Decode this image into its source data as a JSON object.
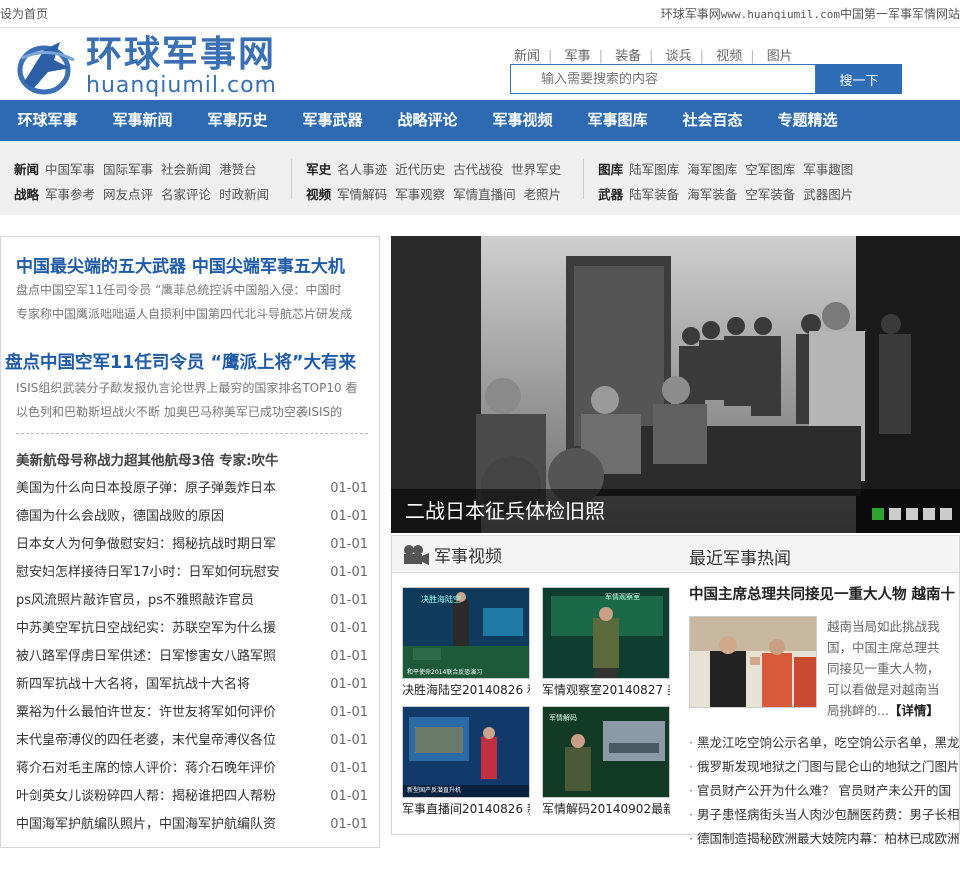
{
  "topbar": {
    "set_home": "设为首页",
    "site_pre": "环球军事网",
    "site_url": "www.huanqiumil.com",
    "site_post": "中国第一军事军情网站"
  },
  "logo": {
    "cn": "环球军事网",
    "en": "huanqiumil.com"
  },
  "quicklinks": [
    "新闻",
    "军事",
    "装备",
    "谈兵",
    "视频",
    "图片"
  ],
  "search": {
    "placeholder": "输入需要搜索的内容",
    "button": "搜一下"
  },
  "nav": [
    "环球军事",
    "军事新闻",
    "军事历史",
    "军事武器",
    "战略评论",
    "军事视频",
    "军事图库",
    "社会百态",
    "专题精选"
  ],
  "subnav": [
    {
      "rows": [
        {
          "head": "新闻",
          "links": [
            "中国军事",
            "国际军事",
            "社会新闻",
            "港赞台"
          ]
        },
        {
          "head": "战略",
          "links": [
            "军事参考",
            "网友点评",
            "名家评论",
            "时政新闻"
          ]
        }
      ]
    },
    {
      "rows": [
        {
          "head": "军史",
          "links": [
            "名人事迹",
            "近代历史",
            "古代战役",
            "世界军史"
          ]
        },
        {
          "head": "视频",
          "links": [
            "军情解码",
            "军事观察",
            "军情直播间",
            "老照片"
          ]
        }
      ]
    },
    {
      "rows": [
        {
          "head": "图库",
          "links": [
            "陆军图库",
            "海军图库",
            "空军图库",
            "军事趣图"
          ]
        },
        {
          "head": "武器",
          "links": [
            "陆军装备",
            "海军装备",
            "空军装备",
            "武器图片"
          ]
        }
      ]
    }
  ],
  "left": {
    "headline1": "中国最尖端的五大武器 中国尖端军事五大机",
    "sub1": [
      [
        "盘点中国空军11任司令员 “鹰",
        "菲总统控诉中国船入侵：中国时"
      ],
      [
        "专家称中国鹰派咄咄逼人自损利",
        "中国第四代北斗导航芯片研发成"
      ]
    ],
    "headline2": "盘点中国空军11任司令员 “鹰派上将”大有来",
    "sub2": [
      [
        "ISIS组织武装分子歃发报仇言论",
        "世界上最穷的国家排名TOP10 看"
      ],
      [
        "以色列和巴勒斯坦战火不断 加",
        "奥巴马称美军已成功空袭ISIS的"
      ]
    ],
    "hot_title": "美新航母号称战力超其他航母3倍 专家:吹牛",
    "news": [
      {
        "title": "美国为什么向日本投原子弹：原子弹轰炸日本",
        "date": "01-01"
      },
      {
        "title": "德国为什么会战败，德国战败的原因",
        "date": "01-01"
      },
      {
        "title": "日本女人为何争做慰安妇：揭秘抗战时期日军",
        "date": "01-01"
      },
      {
        "title": "慰安妇怎样接待日军17小时：日军如何玩慰安",
        "date": "01-01"
      },
      {
        "title": "ps风流照片敲诈官员，ps不雅照敲诈官员",
        "date": "01-01"
      },
      {
        "title": "中苏美空军抗日空战纪实：苏联空军为什么援",
        "date": "01-01"
      },
      {
        "title": "被八路军俘虏日军供述：日军惨害女八路军照",
        "date": "01-01"
      },
      {
        "title": "新四军抗战十大名将，国军抗战十大名将",
        "date": "01-01"
      },
      {
        "title": "粟裕为什么最怕许世友：许世友将军如何评价",
        "date": "01-01"
      },
      {
        "title": "末代皇帝溥仪的四任老婆，末代皇帝溥仪各位",
        "date": "01-01"
      },
      {
        "title": "蒋介石对毛主席的惊人评价：蒋介石晚年评价",
        "date": "01-01"
      },
      {
        "title": "叶剑英女儿谈粉碎四人帮：揭秘谁把四人帮粉",
        "date": "01-01"
      },
      {
        "title": "中国海军护航编队照片，中国海军护航编队资",
        "date": "01-01"
      }
    ]
  },
  "slider": {
    "caption": "二战日本征兵体检旧照",
    "active_index": 0,
    "dot_count": 5
  },
  "video_section": {
    "title": "军事视频",
    "icon": "camera-icon",
    "items": [
      {
        "caption": "决胜海陆空20140826 和"
      },
      {
        "caption": "军情观察室20140827 美"
      },
      {
        "caption": "军事直播间20140826 新"
      },
      {
        "caption": "军情解码20140902最新"
      }
    ],
    "thumb_texts": [
      "决胜海陆空",
      "和平使命2014联合反恐演习",
      "军情观察室",
      "新型国产反潜直升机",
      "军情解码"
    ]
  },
  "hot_section": {
    "title": "最近军事热闻",
    "headline": "中国主席总理共同接见一重大人物 越南十",
    "summary": "越南当局如此挑战我国，中国主席总理共同接见一重大人物，可以看做是对越南当局挑衅的...",
    "detail": "【详情】",
    "list": [
      "黑龙江吃空饷公示名单，吃空饷公示名单，黑龙",
      "俄罗斯发现地狱之门图与昆仑山的地狱之门图片",
      "官员财产公开为什么难？ 官员财产未公开的国",
      "男子患怪病街头当人肉沙包酬医药费：男子长相",
      "德国制造揭秘欧洲最大妓院内幕：柏林已成欧洲"
    ]
  },
  "colors": {
    "brand": "#2d6ab2",
    "headline": "#1f5ba6",
    "slider_active": "#2ea42e"
  }
}
